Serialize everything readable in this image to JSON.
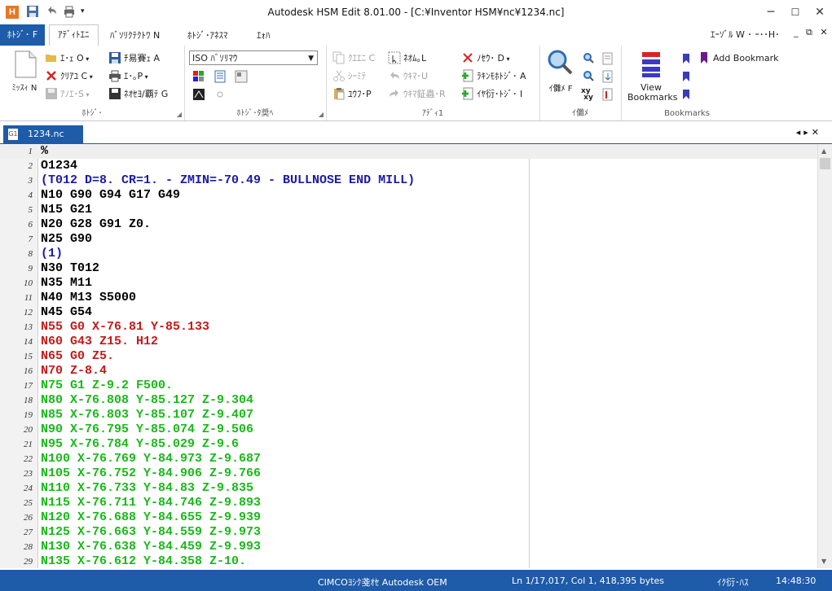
{
  "window": {
    "title": "Autodesk HSM Edit 8.01.00 - [C:¥Inventor HSM¥nc¥1234.nc]"
  },
  "ribbon_tabs": {
    "file": "ﾎﾄｼﾞ･ F",
    "tabs": [
      "ｱﾃﾞｨﾄｴﾆ",
      "ﾊﾞｿﾘｸﾃｸﾄﾜ N",
      "ﾎﾄｼﾞ･ｱﾈｽﾏ",
      "ｴｫﾊ"
    ],
    "active_index": 0,
    "right_menu": "ｴｰｿﾞﾙ W ･ ｰ･･H･"
  },
  "ribbon": {
    "file_group": {
      "new": "ﾐｯｽｨ N",
      "open": "ｴ･ｪ O",
      "clear": "ｸﾘｱﾕ C",
      "close": "ｱﾉｴ･S",
      "save": "ﾁ易賽ｪ A",
      "print": "ｴ･｡P",
      "save_all": "ﾈｵｾﾖ/覇ﾃ G",
      "label": "ﾎﾄｼﾞ･"
    },
    "nc_group": {
      "combo_value": "ISO ﾊﾞｿﾘﾏｳ",
      "label": "ﾎﾄｼﾞ･ﾀ奨ﾍ"
    },
    "edit_group": {
      "copy": "ｸｴｴﾆ C",
      "cut": "ｼｰﾐﾃ",
      "paste": "ﾕｳﾌ･P",
      "select_all": "ﾈｵﾑ｡L",
      "undo": "ｳｷﾏ･U",
      "redo": "ｳｷﾏ鉦蟲･R",
      "delete": "ﾉｾｳ･ D",
      "insert_file": "ﾗｷﾝﾓﾎﾄｼﾞ･ A",
      "insert_line": "ｲﾔ衍･ﾄｼﾞ･ I",
      "label": "ｱﾃﾞｨ1"
    },
    "find_group": {
      "find": "ｲ儺ﾒ F",
      "label": "ｲ儺ﾒ"
    },
    "bookmarks_group": {
      "view": "View Bookmarks",
      "add": "Add Bookmark",
      "label": "Bookmarks"
    }
  },
  "document_tab": {
    "filename": "1234.nc",
    "icon_text": "G1"
  },
  "editor": {
    "lines": [
      {
        "n": "1",
        "text": "%",
        "color": "#000000"
      },
      {
        "n": "2",
        "text": "O1234",
        "color": "#000000"
      },
      {
        "n": "3",
        "text": "(T012 D=8. CR=1. - ZMIN=-70.49 - BULLNOSE END MILL)",
        "color": "#1a1aa8"
      },
      {
        "n": "4",
        "text": "N10 G90 G94 G17 G49",
        "color": "#000000"
      },
      {
        "n": "5",
        "text": "N15 G21",
        "color": "#000000"
      },
      {
        "n": "6",
        "text": "N20 G28 G91 Z0.",
        "color": "#000000"
      },
      {
        "n": "7",
        "text": "N25 G90",
        "color": "#000000"
      },
      {
        "n": "8",
        "text": "(1)",
        "color": "#1a1aa8"
      },
      {
        "n": "9",
        "text": "N30 T012",
        "color": "#000000"
      },
      {
        "n": "10",
        "text": "N35 M11",
        "color": "#000000"
      },
      {
        "n": "11",
        "text": "N40 M13 S5000",
        "color": "#000000"
      },
      {
        "n": "12",
        "text": "N45 G54",
        "color": "#000000"
      },
      {
        "n": "13",
        "text": "N55 G0 X-76.81 Y-85.133",
        "color": "#c41a1a"
      },
      {
        "n": "14",
        "text": "N60 G43 Z15. H12",
        "color": "#c41a1a"
      },
      {
        "n": "15",
        "text": "N65 G0 Z5.",
        "color": "#c41a1a"
      },
      {
        "n": "16",
        "text": "N70 Z-8.4",
        "color": "#c41a1a"
      },
      {
        "n": "17",
        "text": "N75 G1 Z-9.2 F500.",
        "color": "#19b919"
      },
      {
        "n": "18",
        "text": "N80 X-76.808 Y-85.127 Z-9.304",
        "color": "#19b919"
      },
      {
        "n": "19",
        "text": "N85 X-76.803 Y-85.107 Z-9.407",
        "color": "#19b919"
      },
      {
        "n": "20",
        "text": "N90 X-76.795 Y-85.074 Z-9.506",
        "color": "#19b919"
      },
      {
        "n": "21",
        "text": "N95 X-76.784 Y-85.029 Z-9.6",
        "color": "#19b919"
      },
      {
        "n": "22",
        "text": "N100 X-76.769 Y-84.973 Z-9.687",
        "color": "#19b919"
      },
      {
        "n": "23",
        "text": "N105 X-76.752 Y-84.906 Z-9.766",
        "color": "#19b919"
      },
      {
        "n": "24",
        "text": "N110 X-76.733 Y-84.83 Z-9.835",
        "color": "#19b919"
      },
      {
        "n": "25",
        "text": "N115 X-76.711 Y-84.746 Z-9.893",
        "color": "#19b919"
      },
      {
        "n": "26",
        "text": "N120 X-76.688 Y-84.655 Z-9.939",
        "color": "#19b919"
      },
      {
        "n": "27",
        "text": "N125 X-76.663 Y-84.559 Z-9.973",
        "color": "#19b919"
      },
      {
        "n": "28",
        "text": "N130 X-76.638 Y-84.459 Z-9.993",
        "color": "#19b919"
      },
      {
        "n": "29",
        "text": "N135 X-76.612 Y-84.358 Z-10.",
        "color": "#19b919"
      }
    ]
  },
  "status": {
    "oem": "CIMCOﾖｼｸ戔ｵｾ Autodesk OEM",
    "position": "Ln 1/17,017, Col 1, 418,395 bytes",
    "mode": "ｲｸ衍･ﾊｽ",
    "time": "14:48:30"
  },
  "colors": {
    "accent": "#1e5ba8",
    "comment": "#1a1aa8",
    "rapid": "#c41a1a",
    "feed": "#19b919"
  }
}
